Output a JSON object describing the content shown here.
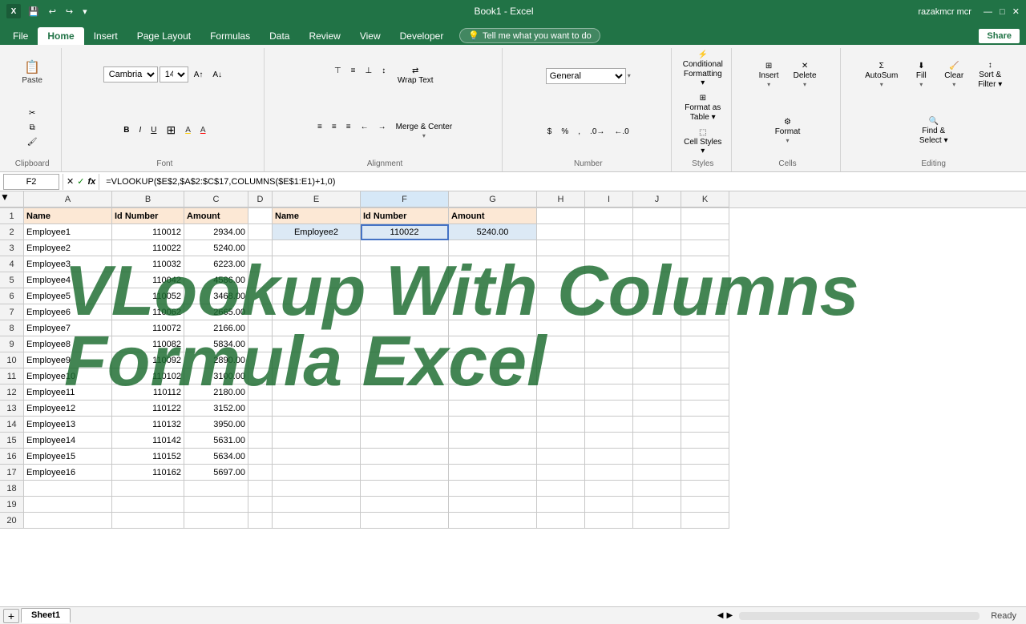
{
  "titleBar": {
    "filename": "Book1 - Excel",
    "user": "razakmcr mcr",
    "saveIcon": "💾",
    "undoIcon": "↩",
    "redoIcon": "↪"
  },
  "ribbon": {
    "tabs": [
      "File",
      "Home",
      "Insert",
      "Page Layout",
      "Formulas",
      "Data",
      "Review",
      "View",
      "Developer"
    ],
    "activeTab": "Home",
    "tellMe": "Tell me what you want to do",
    "shareLabel": "Share",
    "groups": {
      "clipboard": {
        "label": "Clipboard",
        "paste": "Paste",
        "cut": "✂",
        "copy": "⧉",
        "formatPainter": "🖌"
      },
      "font": {
        "label": "Font",
        "fontName": "Cambria",
        "fontSize": "14",
        "boldLabel": "B",
        "italicLabel": "I",
        "underlineLabel": "U",
        "increaseFont": "A↑",
        "decreaseFont": "A↓",
        "borders": "⊞",
        "fillColor": "A",
        "fontColor": "A"
      },
      "alignment": {
        "label": "Alignment",
        "topAlign": "⊤",
        "middleAlign": "≡",
        "bottomAlign": "⊥",
        "leftAlign": "≡",
        "centerAlign": "≡",
        "rightAlign": "≡",
        "wrapText": "Wrap Text",
        "mergeCenter": "Merge & Center",
        "increaseIndent": "→",
        "decreaseIndent": "←",
        "textDirection": "↕"
      },
      "number": {
        "label": "Number",
        "format": "General",
        "currency": "$",
        "percent": "%",
        "comma": ",",
        "increaseDecimal": ".0→",
        "decreaseDecimal": "←.0"
      },
      "styles": {
        "label": "Styles",
        "conditionalFormatting": "Conditional Formatting",
        "formatAsTable": "Format as Table",
        "cellStyles": "Cell Styles"
      },
      "cells": {
        "label": "Cells",
        "insert": "Insert",
        "delete": "Delete",
        "format": "Format"
      },
      "editing": {
        "label": "Editing",
        "autoSum": "AutoSum",
        "fill": "Fill",
        "clear": "Clear",
        "sortFilter": "Sort & Filter",
        "findSelect": "Find & Select"
      }
    }
  },
  "formulaBar": {
    "cellRef": "F2",
    "formula": "=VLOOKUP($E$2,$A$2:$C$17,COLUMNS($E$1:E1)+1,0)",
    "cancelIcon": "✕",
    "confirmIcon": "✓",
    "functionIcon": "fx"
  },
  "columns": {
    "widths": [
      30,
      110,
      90,
      80,
      30,
      110,
      110,
      110,
      60,
      60,
      60,
      60,
      60
    ],
    "labels": [
      "",
      "A",
      "B",
      "C",
      "D",
      "E",
      "F",
      "G",
      "H",
      "I",
      "J",
      "K"
    ]
  },
  "rows": [
    {
      "num": 1,
      "cells": [
        "Name",
        "Id Number",
        "Amount",
        "",
        "Name",
        "Id Number",
        "Amount",
        "",
        "",
        "",
        ""
      ]
    },
    {
      "num": 2,
      "cells": [
        "Employee1",
        "110012",
        "2934.00",
        "",
        "Employee2",
        "110022",
        "5240.00",
        "",
        "",
        "",
        ""
      ]
    },
    {
      "num": 3,
      "cells": [
        "Employee2",
        "110022",
        "5240.00",
        "",
        "",
        "",
        "",
        "",
        "",
        "",
        ""
      ]
    },
    {
      "num": 4,
      "cells": [
        "Employee3",
        "110032",
        "6223.00",
        "",
        "",
        "",
        "",
        "",
        "",
        "",
        ""
      ]
    },
    {
      "num": 5,
      "cells": [
        "Employee4",
        "110042",
        "4586.00",
        "",
        "",
        "",
        "",
        "",
        "",
        "",
        ""
      ]
    },
    {
      "num": 6,
      "cells": [
        "Employee5",
        "110052",
        "3468.00",
        "",
        "",
        "",
        "",
        "",
        "",
        "",
        ""
      ]
    },
    {
      "num": 7,
      "cells": [
        "Employee6",
        "110062",
        "2665.00",
        "",
        "",
        "",
        "",
        "",
        "",
        "",
        ""
      ]
    },
    {
      "num": 8,
      "cells": [
        "Employee7",
        "110072",
        "2166.00",
        "",
        "",
        "",
        "",
        "",
        "",
        "",
        ""
      ]
    },
    {
      "num": 9,
      "cells": [
        "Employee8",
        "110082",
        "5834.00",
        "",
        "",
        "",
        "",
        "",
        "",
        "",
        ""
      ]
    },
    {
      "num": 10,
      "cells": [
        "Employee9",
        "110092",
        "2890.00",
        "",
        "",
        "",
        "",
        "",
        "",
        "",
        ""
      ]
    },
    {
      "num": 11,
      "cells": [
        "Employee10",
        "110102",
        "3100.00",
        "",
        "",
        "",
        "",
        "",
        "",
        "",
        ""
      ]
    },
    {
      "num": 12,
      "cells": [
        "Employee11",
        "110112",
        "2180.00",
        "",
        "",
        "",
        "",
        "",
        "",
        "",
        ""
      ]
    },
    {
      "num": 13,
      "cells": [
        "Employee12",
        "110122",
        "3152.00",
        "",
        "",
        "",
        "",
        "",
        "",
        "",
        ""
      ]
    },
    {
      "num": 14,
      "cells": [
        "Employee13",
        "110132",
        "3950.00",
        "",
        "",
        "",
        "",
        "",
        "",
        "",
        ""
      ]
    },
    {
      "num": 15,
      "cells": [
        "Employee14",
        "110142",
        "5631.00",
        "",
        "",
        "",
        "",
        "",
        "",
        "",
        ""
      ]
    },
    {
      "num": 16,
      "cells": [
        "Employee15",
        "110152",
        "5634.00",
        "",
        "",
        "",
        "",
        "",
        "",
        "",
        ""
      ]
    },
    {
      "num": 17,
      "cells": [
        "Employee16",
        "110162",
        "5697.00",
        "",
        "",
        "",
        "",
        "",
        "",
        "",
        ""
      ]
    },
    {
      "num": 18,
      "cells": [
        "",
        "",
        "",
        "",
        "",
        "",
        "",
        "",
        "",
        "",
        ""
      ]
    },
    {
      "num": 19,
      "cells": [
        "",
        "",
        "",
        "",
        "",
        "",
        "",
        "",
        "",
        "",
        ""
      ]
    },
    {
      "num": 20,
      "cells": [
        "",
        "",
        "",
        "",
        "",
        "",
        "",
        "",
        "",
        "",
        ""
      ]
    }
  ],
  "watermark": {
    "line1": "VLookup With Columns",
    "line2": "Formula Excel"
  },
  "sheetTabs": {
    "tabs": [
      "Sheet1"
    ],
    "active": "Sheet1"
  },
  "statusBar": {
    "ready": "Ready"
  },
  "colors": {
    "excelGreen": "#217346",
    "headerOrange": "#fce8d5",
    "lookupBlue": "#dce9f5",
    "lookupResult": "#c0d6f0",
    "watermarkGreen": "#1a6b2e"
  }
}
